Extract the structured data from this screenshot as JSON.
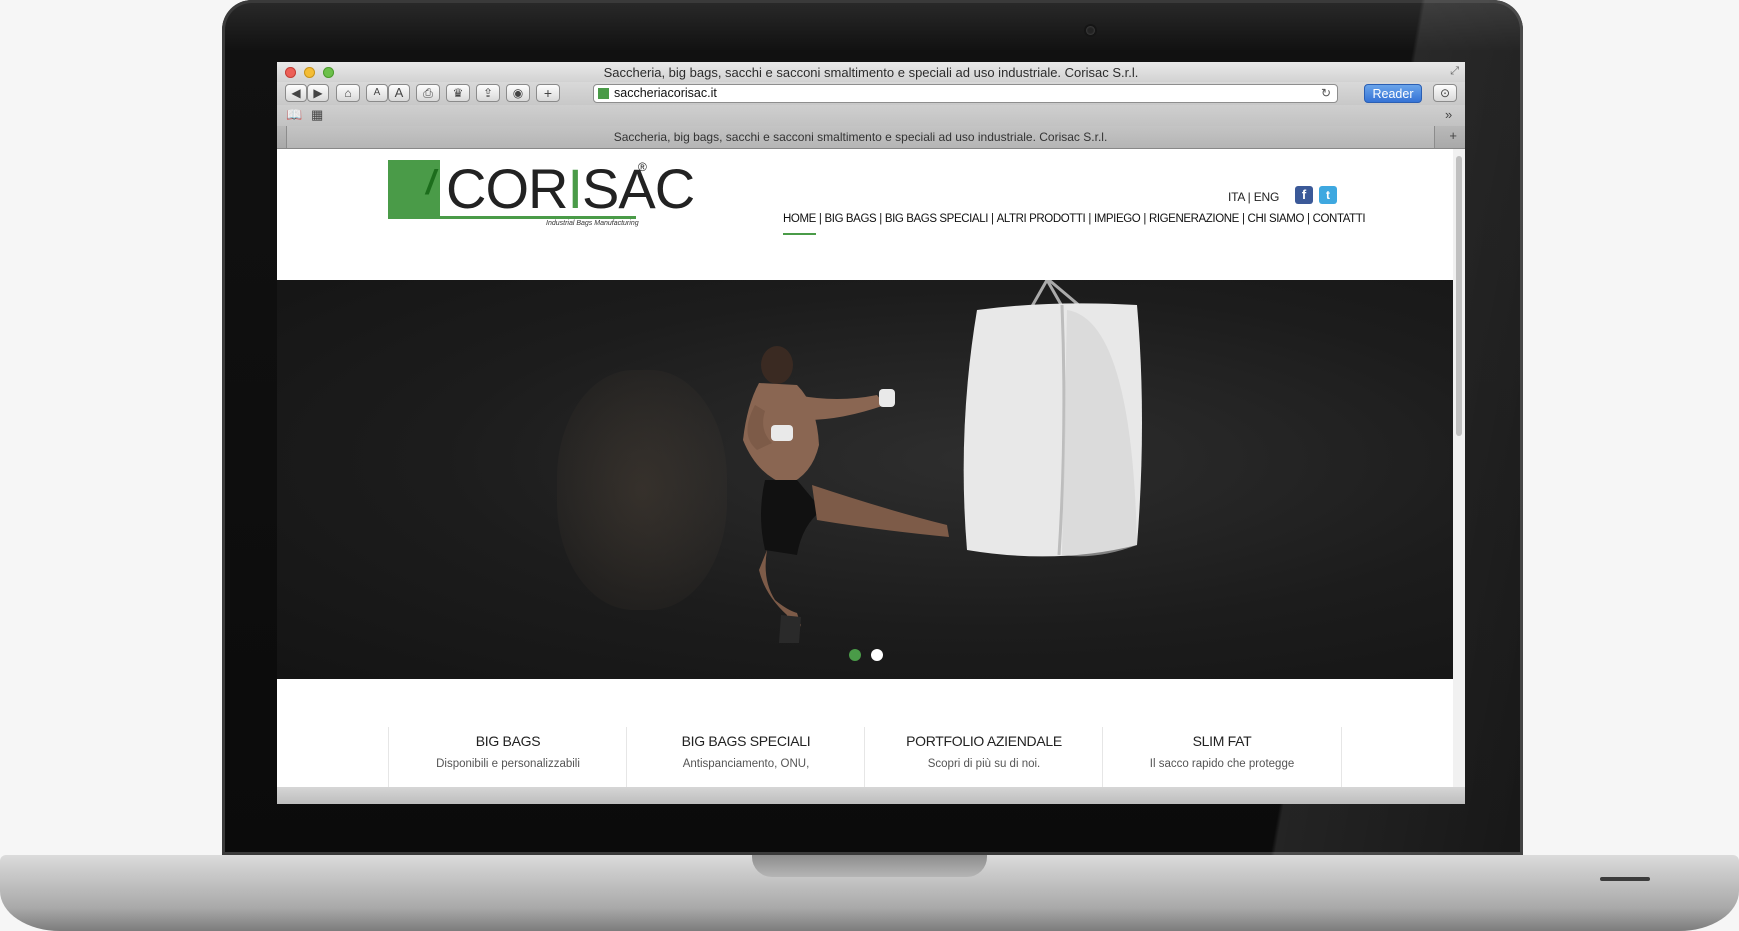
{
  "window": {
    "title": "Saccheria, big bags, sacchi e sacconi smaltimento e speciali ad uso industriale. Corisac S.r.l."
  },
  "toolbar": {
    "url": "saccheriacorisac.it",
    "reader_label": "Reader",
    "font_small": "A",
    "font_large": "A",
    "add": "+"
  },
  "tab": {
    "title": "Saccheria, big bags, sacchi e sacconi smaltimento e speciali ad uso industriale. Corisac S.r.l."
  },
  "site": {
    "logo": {
      "text_dark": "COR",
      "text_green": "I",
      "text_dark2": "SAC",
      "registered": "®",
      "tagline": "Industrial Bags Manufacturing"
    },
    "lang": "ITA | ENG",
    "social": {
      "facebook": "f",
      "twitter": "t"
    },
    "nav": [
      "HOME",
      "BIG BAGS",
      "BIG BAGS SPECIALI",
      "ALTRI PRODOTTI",
      "IMPIEGO",
      "RIGENERAZIONE",
      "CHI SIAMO",
      "CONTATTI"
    ],
    "nav_separator": "|",
    "features": [
      {
        "title": "BIG BAGS",
        "desc": "Disponibili e personalizzabili"
      },
      {
        "title": "BIG BAGS SPECIALI",
        "desc": "Antispanciamento, ONU,"
      },
      {
        "title": "PORTFOLIO AZIENDALE",
        "desc": "Scopri di più su di noi."
      },
      {
        "title": "SLIM FAT",
        "desc": "Il sacco rapido che protegge"
      }
    ]
  },
  "colors": {
    "brand_green": "#4a9b48",
    "reader_blue": "#3573d6"
  }
}
